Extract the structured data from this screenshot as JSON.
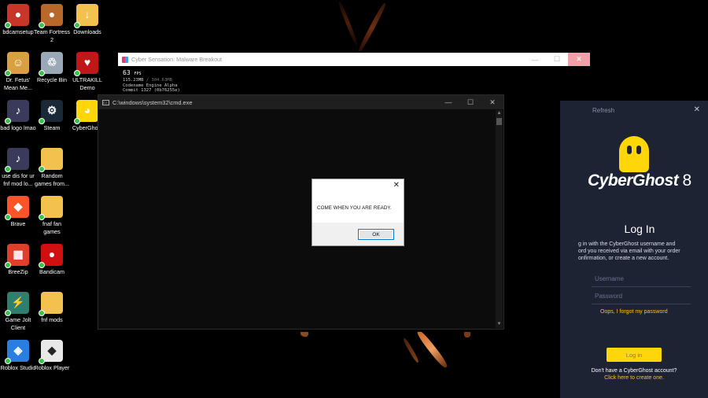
{
  "desktop": {
    "icons": [
      {
        "label": "bdcamsetup",
        "icon": "bandicam-setup-icon",
        "color": "#c8362a"
      },
      {
        "label": "Team Fortress 2",
        "icon": "team-fortress-icon",
        "color": "#b8682a"
      },
      {
        "label": "Downloads",
        "icon": "folder-download-icon",
        "color": "#f2c14e"
      },
      {
        "label": "Dr. Fetus' Mean Me...",
        "icon": "game-icon",
        "color": "#d8a040"
      },
      {
        "label": "Recycle Bin",
        "icon": "recycle-bin-icon",
        "color": "#9aa8b8"
      },
      {
        "label": "ULTRAKILL Demo",
        "icon": "ultrakill-icon",
        "color": "#c01818"
      },
      {
        "label": "bad logo lmao",
        "icon": "fnf-logo-icon",
        "color": "#3a3a5a"
      },
      {
        "label": "Steam",
        "icon": "steam-icon",
        "color": "#1b2838"
      },
      {
        "label": "CyberGhost",
        "icon": "cyberghost-icon",
        "color": "#ffd60a"
      },
      {
        "label": "use dis for ur fnf mod lo...",
        "icon": "fnf-logo-icon",
        "color": "#3a3a5a"
      },
      {
        "label": "Random games from...",
        "icon": "folder-icon",
        "color": "#f2c14e"
      },
      {
        "label": "Brave",
        "icon": "brave-icon",
        "color": "#fb542b"
      },
      {
        "label": "fnaf fan games",
        "icon": "folder-icon",
        "color": "#f2c14e"
      },
      {
        "label": "BreeZip",
        "icon": "breezip-icon",
        "color": "#e0402a"
      },
      {
        "label": "Bandicam",
        "icon": "bandicam-icon",
        "color": "#d01010"
      },
      {
        "label": "Game Jolt Client",
        "icon": "game-jolt-icon",
        "color": "#2f7f6f"
      },
      {
        "label": "fnf mods",
        "icon": "folder-icon",
        "color": "#f2c14e"
      },
      {
        "label": "Roblox Studio",
        "icon": "roblox-studio-icon",
        "color": "#2a7ee0"
      },
      {
        "label": "Roblox Player",
        "icon": "roblox-icon",
        "color": "#e8e8e8"
      }
    ]
  },
  "game_window": {
    "title": "Cyber Sensation: Malware Breakout",
    "fps_value": "63",
    "fps_unit": "FPS",
    "mem_used": "115.23MB",
    "mem_total": "/ 304.63MB",
    "engine": "Codename Engine Alpha",
    "commit": "Commit 1327 (0b76255e)",
    "min_icon": "—",
    "max_icon": "☐",
    "close_icon": "✕"
  },
  "cmd_window": {
    "title": "C:\\windows\\system32\\cmd.exe",
    "min_icon": "—",
    "max_icon": "☐",
    "close_icon": "✕"
  },
  "dialog": {
    "message": "COME WHEN YOU ARE READY.",
    "ok_label": "OK",
    "close_icon": "✕"
  },
  "cyberghost": {
    "refresh_label": "Refresh",
    "close_icon": "✕",
    "brand": "CyberGhost",
    "version": "8",
    "login_title": "Log In",
    "desc_line1": "g in with the CyberGhost username and",
    "desc_line2": "ord you received via email with your order",
    "desc_line3": "onfirmation, or create a new account.",
    "username_placeholder": "Username",
    "password_placeholder": "Password",
    "forgot_link": "Oops, I forgot my password",
    "login_button": "Log in",
    "no_account": "Don't have a CyberGhost account?",
    "create_link": "Click here to create one.",
    "accent": "#ffd60a"
  }
}
